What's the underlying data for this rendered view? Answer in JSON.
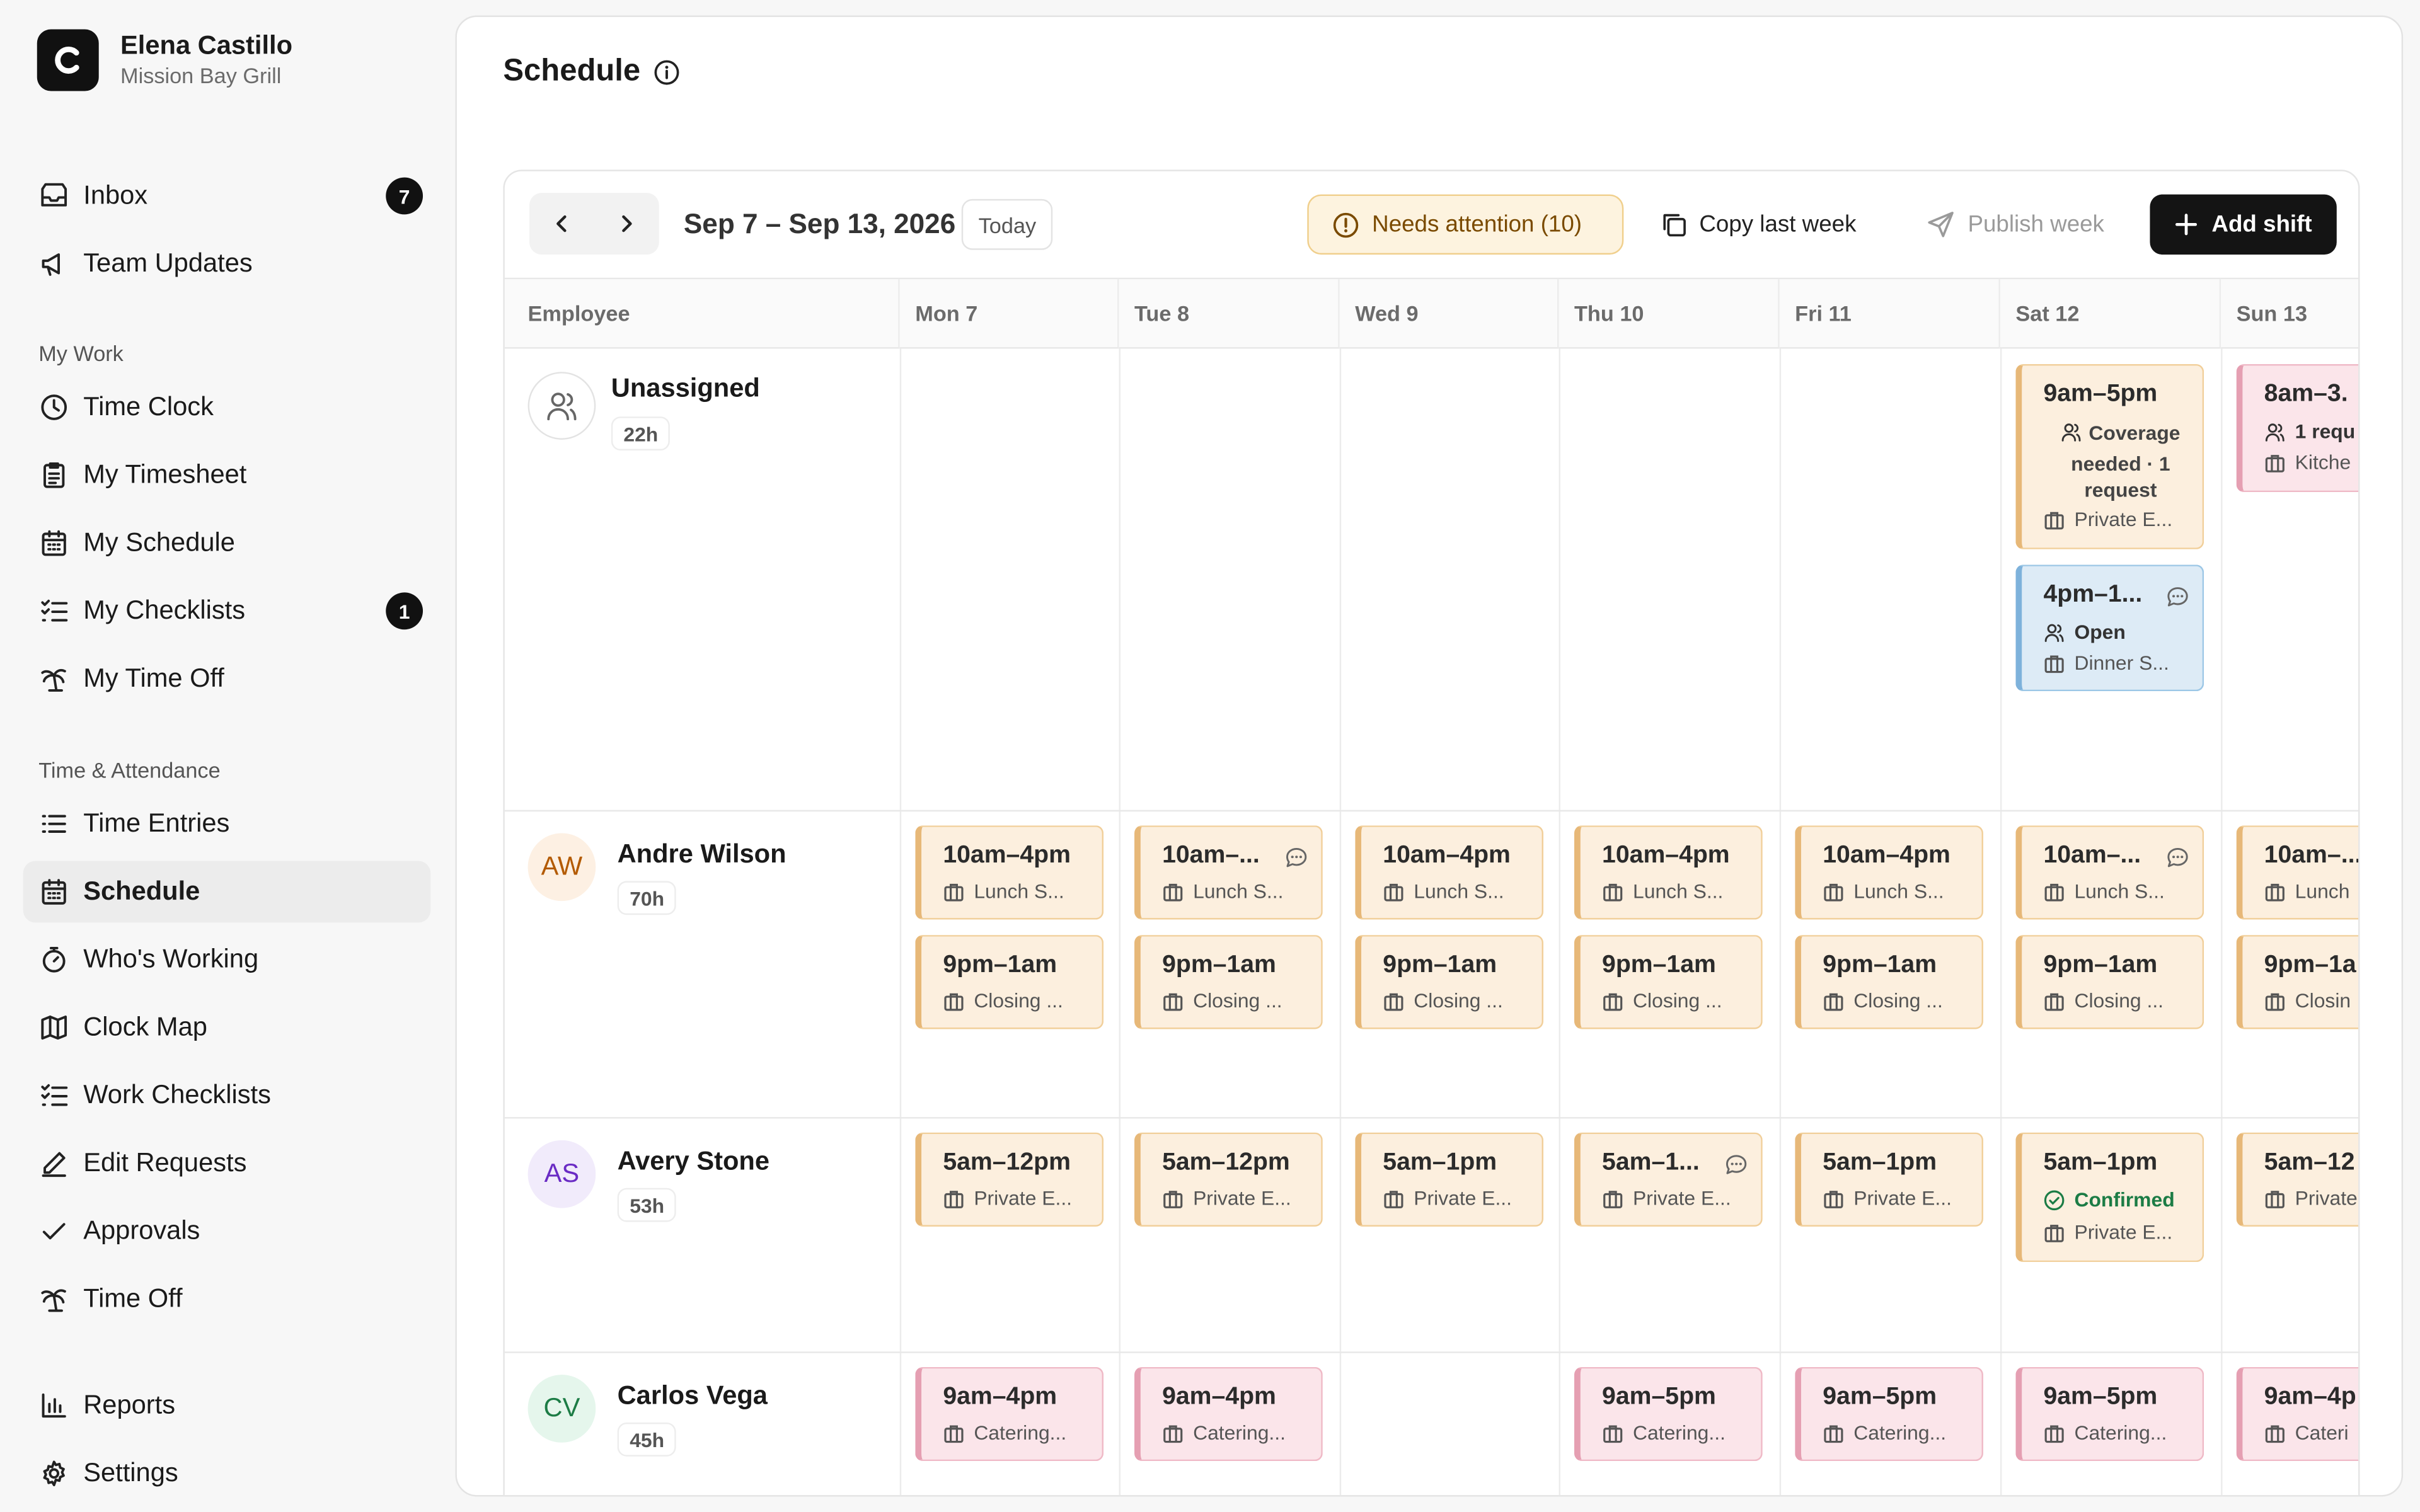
{
  "profile": {
    "name": "Elena Castillo",
    "location": "Mission Bay Grill"
  },
  "sidebar": {
    "top": [
      {
        "label": "Inbox",
        "icon": "inbox-icon",
        "badge": "7"
      },
      {
        "label": "Team Updates",
        "icon": "megaphone-icon"
      }
    ],
    "sections": [
      {
        "title": "My Work",
        "items": [
          {
            "label": "Time Clock",
            "icon": "clock-icon"
          },
          {
            "label": "My Timesheet",
            "icon": "clipboard-icon"
          },
          {
            "label": "My Schedule",
            "icon": "calendar-icon"
          },
          {
            "label": "My Checklists",
            "icon": "checklist-icon",
            "badge": "1"
          },
          {
            "label": "My Time Off",
            "icon": "palm-tree-icon"
          }
        ]
      },
      {
        "title": "Time & Attendance",
        "items": [
          {
            "label": "Time Entries",
            "icon": "list-icon"
          },
          {
            "label": "Schedule",
            "icon": "calendar-icon",
            "active": true
          },
          {
            "label": "Who's Working",
            "icon": "stopwatch-icon"
          },
          {
            "label": "Clock Map",
            "icon": "map-icon"
          },
          {
            "label": "Work Checklists",
            "icon": "checklist-icon"
          },
          {
            "label": "Edit Requests",
            "icon": "pencil-icon"
          },
          {
            "label": "Approvals",
            "icon": "check-icon"
          },
          {
            "label": "Time Off",
            "icon": "palm-tree-icon"
          }
        ]
      }
    ],
    "bottom": [
      {
        "label": "Reports",
        "icon": "bar-chart-icon"
      },
      {
        "label": "Settings",
        "icon": "gear-icon"
      }
    ]
  },
  "page": {
    "title": "Schedule"
  },
  "toolbar": {
    "date_range": "Sep 7 – Sep 13, 2026",
    "today": "Today",
    "needs_attention": "Needs attention (10)",
    "copy_last_week": "Copy last week",
    "publish_week": "Publish week",
    "add_shift": "Add shift"
  },
  "columns": [
    "Employee",
    "Mon 7",
    "Tue 8",
    "Wed 9",
    "Thu 10",
    "Fri 11",
    "Sat 12",
    "Sun 13"
  ],
  "rows": [
    {
      "name": "Unassigned",
      "hours": "22h",
      "initials": "",
      "avatar_bg": "#ffffff",
      "avatar_fg": "#6b6b6b",
      "shifts": [
        {
          "day": 5,
          "slot": "coverage",
          "time": "9am–5pm",
          "note": "Coverage needed · 1 request",
          "location": "Private E...",
          "color": "orange"
        },
        {
          "day": 5,
          "slot": "open",
          "time": "4pm–1...",
          "status": "Open",
          "location": "Dinner S...",
          "color": "blue",
          "chat": true
        },
        {
          "day": 6,
          "slot": "coverage-cut",
          "time": "8am–3.",
          "note": "1 requ",
          "location": "Kitche",
          "color": "pink"
        }
      ]
    },
    {
      "name": "Andre Wilson",
      "hours": "70h",
      "initials": "AW",
      "avatar_bg": "#fdf0e3",
      "avatar_fg": "#b35a00",
      "shifts": [
        {
          "day": 0,
          "slot": 0,
          "time": "10am–4pm",
          "location": "Lunch S...",
          "color": "orange"
        },
        {
          "day": 1,
          "slot": 0,
          "time": "10am–...",
          "location": "Lunch S...",
          "color": "orange",
          "chat": true
        },
        {
          "day": 2,
          "slot": 0,
          "time": "10am–4pm",
          "location": "Lunch S...",
          "color": "orange"
        },
        {
          "day": 3,
          "slot": 0,
          "time": "10am–4pm",
          "location": "Lunch S...",
          "color": "orange"
        },
        {
          "day": 4,
          "slot": 0,
          "time": "10am–4pm",
          "location": "Lunch S...",
          "color": "orange"
        },
        {
          "day": 5,
          "slot": 0,
          "time": "10am–...",
          "location": "Lunch S...",
          "color": "orange",
          "chat": true
        },
        {
          "day": 6,
          "slot": 0,
          "time": "10am–...",
          "location": "Lunch",
          "color": "orange"
        },
        {
          "day": 0,
          "slot": 1,
          "time": "9pm–1am",
          "location": "Closing ...",
          "color": "orange"
        },
        {
          "day": 1,
          "slot": 1,
          "time": "9pm–1am",
          "location": "Closing ...",
          "color": "orange"
        },
        {
          "day": 2,
          "slot": 1,
          "time": "9pm–1am",
          "location": "Closing ...",
          "color": "orange"
        },
        {
          "day": 3,
          "slot": 1,
          "time": "9pm–1am",
          "location": "Closing ...",
          "color": "orange"
        },
        {
          "day": 4,
          "slot": 1,
          "time": "9pm–1am",
          "location": "Closing ...",
          "color": "orange"
        },
        {
          "day": 5,
          "slot": 1,
          "time": "9pm–1am",
          "location": "Closing ...",
          "color": "orange"
        },
        {
          "day": 6,
          "slot": 1,
          "time": "9pm–1a",
          "location": "Closin",
          "color": "orange"
        }
      ]
    },
    {
      "name": "Avery Stone",
      "hours": "53h",
      "initials": "AS",
      "avatar_bg": "#f1ebfb",
      "avatar_fg": "#6a2bc4",
      "shifts": [
        {
          "day": 0,
          "slot": 0,
          "time": "5am–12pm",
          "location": "Private E...",
          "color": "orange"
        },
        {
          "day": 1,
          "slot": 0,
          "time": "5am–12pm",
          "location": "Private E...",
          "color": "orange"
        },
        {
          "day": 2,
          "slot": 0,
          "time": "5am–1pm",
          "location": "Private E...",
          "color": "orange"
        },
        {
          "day": 3,
          "slot": 0,
          "time": "5am–1...",
          "location": "Private E...",
          "color": "orange",
          "chat": true
        },
        {
          "day": 4,
          "slot": 0,
          "time": "5am–1pm",
          "location": "Private E...",
          "color": "orange"
        },
        {
          "day": 5,
          "slot": 0,
          "time": "5am–1pm",
          "status": "Confirmed",
          "location": "Private E...",
          "color": "orange"
        },
        {
          "day": 6,
          "slot": 0,
          "time": "5am–12",
          "location": "Private",
          "color": "orange"
        }
      ]
    },
    {
      "name": "Carlos Vega",
      "hours": "45h",
      "initials": "CV",
      "avatar_bg": "#e5f6ec",
      "avatar_fg": "#1c7c45",
      "shifts": [
        {
          "day": 0,
          "slot": 0,
          "time": "9am–4pm",
          "location": "Catering...",
          "color": "pink"
        },
        {
          "day": 1,
          "slot": 0,
          "time": "9am–4pm",
          "location": "Catering...",
          "color": "pink"
        },
        {
          "day": 3,
          "slot": 0,
          "time": "9am–5pm",
          "location": "Catering...",
          "color": "pink"
        },
        {
          "day": 4,
          "slot": 0,
          "time": "9am–5pm",
          "location": "Catering...",
          "color": "pink"
        },
        {
          "day": 5,
          "slot": 0,
          "time": "9am–5pm",
          "location": "Catering...",
          "color": "pink"
        },
        {
          "day": 6,
          "slot": 0,
          "time": "9am–4p",
          "location": "Cateri",
          "color": "pink"
        }
      ]
    }
  ]
}
